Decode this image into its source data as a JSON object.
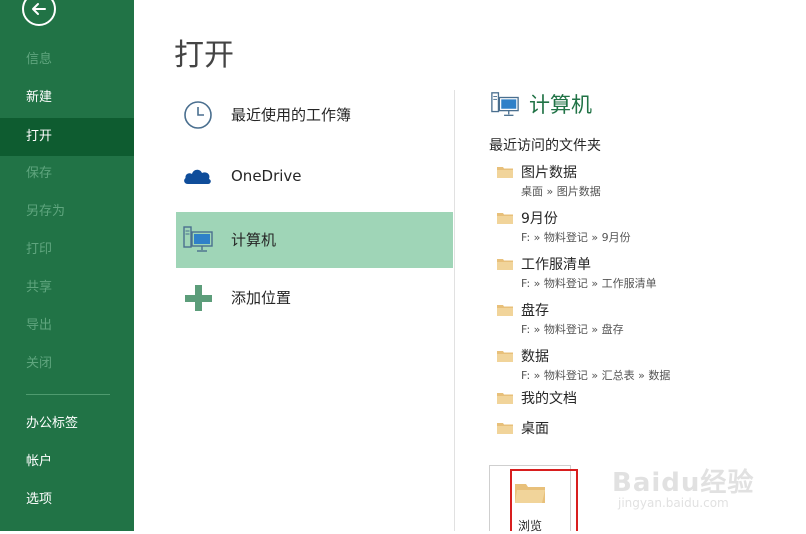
{
  "sidebar": {
    "items": [
      {
        "label": "信息",
        "state": "disabled"
      },
      {
        "label": "新建",
        "state": "normal"
      },
      {
        "label": "打开",
        "state": "selected"
      },
      {
        "label": "保存",
        "state": "disabled"
      },
      {
        "label": "另存为",
        "state": "disabled"
      },
      {
        "label": "打印",
        "state": "disabled"
      },
      {
        "label": "共享",
        "state": "disabled"
      },
      {
        "label": "导出",
        "state": "disabled"
      },
      {
        "label": "关闭",
        "state": "disabled"
      },
      {
        "label": "办公标签",
        "state": "normal"
      },
      {
        "label": "帐户",
        "state": "normal"
      },
      {
        "label": "选项",
        "state": "normal"
      }
    ]
  },
  "page": {
    "title": "打开"
  },
  "places": [
    {
      "label": "最近使用的工作簿",
      "icon": "clock-icon"
    },
    {
      "label": "OneDrive",
      "icon": "onedrive-cloud-icon"
    },
    {
      "label": "计算机",
      "icon": "computer-icon",
      "selected": true
    },
    {
      "label": "添加位置",
      "icon": "plus-icon"
    }
  ],
  "right_panel": {
    "title": "计算机",
    "recent_header": "最近访问的文件夹",
    "folders": [
      {
        "name": "图片数据",
        "path": "桌面 » 图片数据"
      },
      {
        "name": "9月份",
        "path": "F: » 物料登记 » 9月份"
      },
      {
        "name": "工作服清单",
        "path": "F: » 物料登记 » 工作服清单"
      },
      {
        "name": "盘存",
        "path": "F: » 物料登记 » 盘存"
      },
      {
        "name": "数据",
        "path": "F: » 物料登记 » 汇总表 » 数据"
      },
      {
        "name": "我的文档",
        "path": ""
      },
      {
        "name": "桌面",
        "path": ""
      }
    ],
    "browse_label": "浏览"
  },
  "watermark": {
    "main": "Baidu经验",
    "sub": "jingyan.baidu.com"
  },
  "colors": {
    "sidebar": "#217346",
    "sidebar_selected": "#0e5c30",
    "place_selected": "#9fd5b7",
    "accent": "#217346",
    "folder": "#e8c07a",
    "browse_highlight": "#d81e1e"
  }
}
